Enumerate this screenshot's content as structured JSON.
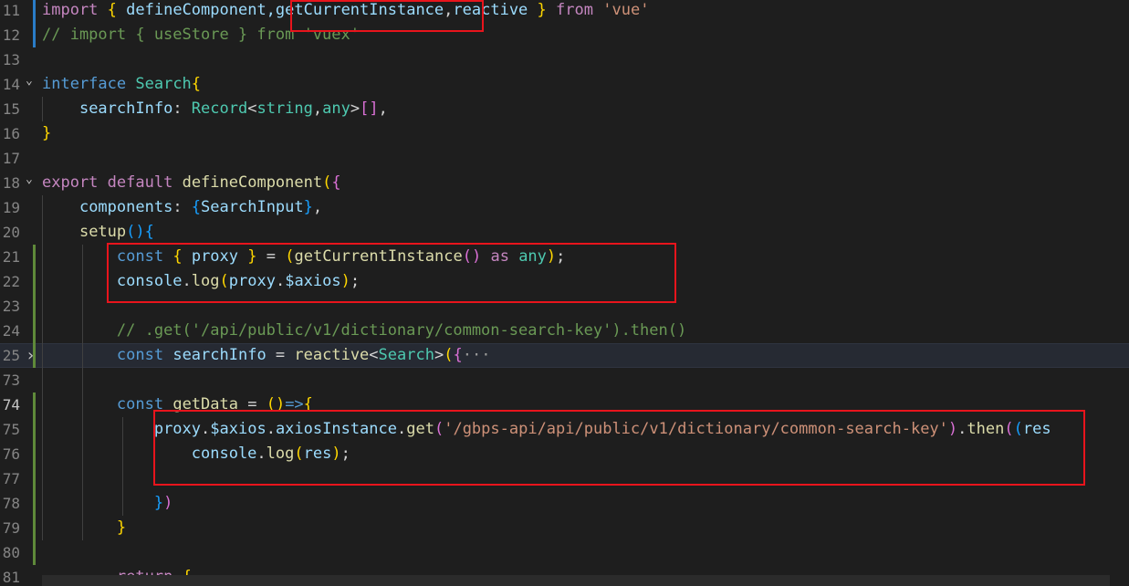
{
  "editor": {
    "line_numbers": [
      "11",
      "12",
      "13",
      "14",
      "15",
      "16",
      "17",
      "18",
      "19",
      "20",
      "21",
      "22",
      "23",
      "24",
      "25",
      "73",
      "74",
      "75",
      "76",
      "77",
      "78",
      "79",
      "80",
      "81"
    ],
    "colors": {
      "background": "#1e1e1e",
      "highlight_box": "#e8141c",
      "current_line": "#262a33"
    },
    "lines": [
      {
        "tokens": [
          {
            "t": "import",
            "c": "ctl"
          },
          {
            "t": " "
          },
          {
            "t": "{",
            "c": "b1"
          },
          {
            "t": " defineComponent,",
            "c": "var"
          },
          {
            "t": "getCurrentInstance",
            "c": "var"
          },
          {
            "t": ",",
            "c": "pl"
          },
          {
            "t": "reactive",
            "c": "var"
          },
          {
            "t": " "
          },
          {
            "t": "}",
            "c": "b1"
          },
          {
            "t": " "
          },
          {
            "t": "from",
            "c": "ctl"
          },
          {
            "t": " "
          },
          {
            "t": "'vue'",
            "c": "str"
          }
        ]
      },
      {
        "tokens": [
          {
            "t": "// import { useStore } from 'vuex'",
            "c": "com"
          }
        ]
      },
      {
        "tokens": []
      },
      {
        "tokens": [
          {
            "t": "interface",
            "c": "kw"
          },
          {
            "t": " "
          },
          {
            "t": "Search",
            "c": "ty"
          },
          {
            "t": "{",
            "c": "b1"
          }
        ]
      },
      {
        "tokens": [
          {
            "t": "    "
          },
          {
            "t": "searchInfo",
            "c": "var"
          },
          {
            "t": ": ",
            "c": "pl"
          },
          {
            "t": "Record",
            "c": "ty"
          },
          {
            "t": "<",
            "c": "pl"
          },
          {
            "t": "string",
            "c": "ty"
          },
          {
            "t": ",",
            "c": "pl"
          },
          {
            "t": "any",
            "c": "ty"
          },
          {
            "t": ">",
            "c": "pl"
          },
          {
            "t": "[]",
            "c": "b2"
          },
          {
            "t": ",",
            "c": "pl"
          }
        ]
      },
      {
        "tokens": [
          {
            "t": "}",
            "c": "b1"
          }
        ]
      },
      {
        "tokens": []
      },
      {
        "tokens": [
          {
            "t": "export",
            "c": "ctl"
          },
          {
            "t": " "
          },
          {
            "t": "default",
            "c": "ctl"
          },
          {
            "t": " "
          },
          {
            "t": "defineComponent",
            "c": "fn"
          },
          {
            "t": "(",
            "c": "b1"
          },
          {
            "t": "{",
            "c": "b2"
          }
        ]
      },
      {
        "tokens": [
          {
            "t": "    "
          },
          {
            "t": "components",
            "c": "var"
          },
          {
            "t": ": ",
            "c": "pl"
          },
          {
            "t": "{",
            "c": "b3"
          },
          {
            "t": "SearchInput",
            "c": "var"
          },
          {
            "t": "}",
            "c": "b3"
          },
          {
            "t": ",",
            "c": "pl"
          }
        ]
      },
      {
        "tokens": [
          {
            "t": "    "
          },
          {
            "t": "setup",
            "c": "fn"
          },
          {
            "t": "()",
            "c": "b3"
          },
          {
            "t": "{",
            "c": "b3"
          }
        ]
      },
      {
        "tokens": [
          {
            "t": "        "
          },
          {
            "t": "const",
            "c": "kw"
          },
          {
            "t": " "
          },
          {
            "t": "{",
            "c": "b1"
          },
          {
            "t": " "
          },
          {
            "t": "proxy",
            "c": "var"
          },
          {
            "t": " "
          },
          {
            "t": "}",
            "c": "b1"
          },
          {
            "t": " = ",
            "c": "pl"
          },
          {
            "t": "(",
            "c": "b1"
          },
          {
            "t": "getCurrentInstance",
            "c": "fn"
          },
          {
            "t": "()",
            "c": "b2"
          },
          {
            "t": " "
          },
          {
            "t": "as",
            "c": "ctl"
          },
          {
            "t": " "
          },
          {
            "t": "any",
            "c": "ty"
          },
          {
            "t": ")",
            "c": "b1"
          },
          {
            "t": ";",
            "c": "pl"
          }
        ]
      },
      {
        "tokens": [
          {
            "t": "        "
          },
          {
            "t": "console",
            "c": "var"
          },
          {
            "t": ".",
            "c": "pl"
          },
          {
            "t": "log",
            "c": "fn"
          },
          {
            "t": "(",
            "c": "b1"
          },
          {
            "t": "proxy",
            "c": "var"
          },
          {
            "t": ".",
            "c": "pl"
          },
          {
            "t": "$axios",
            "c": "var"
          },
          {
            "t": ")",
            "c": "b1"
          },
          {
            "t": ";",
            "c": "pl"
          }
        ]
      },
      {
        "tokens": []
      },
      {
        "tokens": [
          {
            "t": "        "
          },
          {
            "t": "// .get('/api/public/v1/dictionary/common-search-key').then()",
            "c": "com"
          }
        ]
      },
      {
        "tokens": [
          {
            "t": "        "
          },
          {
            "t": "const",
            "c": "kw"
          },
          {
            "t": " "
          },
          {
            "t": "searchInfo",
            "c": "var"
          },
          {
            "t": " = ",
            "c": "pl"
          },
          {
            "t": "reactive",
            "c": "fn"
          },
          {
            "t": "<",
            "c": "pl"
          },
          {
            "t": "Search",
            "c": "ty"
          },
          {
            "t": ">",
            "c": "pl"
          },
          {
            "t": "(",
            "c": "b1"
          },
          {
            "t": "{",
            "c": "b2"
          },
          {
            "t": "···",
            "c": "fold-ell"
          }
        ]
      },
      {
        "tokens": []
      },
      {
        "tokens": [
          {
            "t": "        "
          },
          {
            "t": "const",
            "c": "kw"
          },
          {
            "t": " "
          },
          {
            "t": "getData",
            "c": "fn"
          },
          {
            "t": " = ",
            "c": "pl"
          },
          {
            "t": "()",
            "c": "b1"
          },
          {
            "t": "=>",
            "c": "kw"
          },
          {
            "t": "{",
            "c": "b1"
          }
        ]
      },
      {
        "tokens": [
          {
            "t": "            "
          },
          {
            "t": "proxy",
            "c": "var"
          },
          {
            "t": ".",
            "c": "pl"
          },
          {
            "t": "$axios",
            "c": "var"
          },
          {
            "t": ".",
            "c": "pl"
          },
          {
            "t": "axiosInstance",
            "c": "var"
          },
          {
            "t": ".",
            "c": "pl"
          },
          {
            "t": "get",
            "c": "fn"
          },
          {
            "t": "(",
            "c": "b2"
          },
          {
            "t": "'/gbps-api/api/public/v1/dictionary/common-search-key'",
            "c": "str"
          },
          {
            "t": ")",
            "c": "b2"
          },
          {
            "t": ".",
            "c": "pl"
          },
          {
            "t": "then",
            "c": "fn"
          },
          {
            "t": "(",
            "c": "b2"
          },
          {
            "t": "(",
            "c": "b3"
          },
          {
            "t": "res",
            "c": "var"
          }
        ]
      },
      {
        "tokens": [
          {
            "t": "                "
          },
          {
            "t": "console",
            "c": "var"
          },
          {
            "t": ".",
            "c": "pl"
          },
          {
            "t": "log",
            "c": "fn"
          },
          {
            "t": "(",
            "c": "b1"
          },
          {
            "t": "res",
            "c": "var"
          },
          {
            "t": ")",
            "c": "b1"
          },
          {
            "t": ";",
            "c": "pl"
          }
        ]
      },
      {
        "tokens": []
      },
      {
        "tokens": [
          {
            "t": "            "
          },
          {
            "t": "}",
            "c": "b3"
          },
          {
            "t": ")",
            "c": "b2"
          }
        ]
      },
      {
        "tokens": [
          {
            "t": "        "
          },
          {
            "t": "}",
            "c": "b1"
          }
        ]
      },
      {
        "tokens": []
      },
      {
        "tokens": [
          {
            "t": "        "
          },
          {
            "t": "return",
            "c": "ctl"
          },
          {
            "t": " "
          },
          {
            "t": "{",
            "c": "b1"
          }
        ]
      }
    ]
  }
}
